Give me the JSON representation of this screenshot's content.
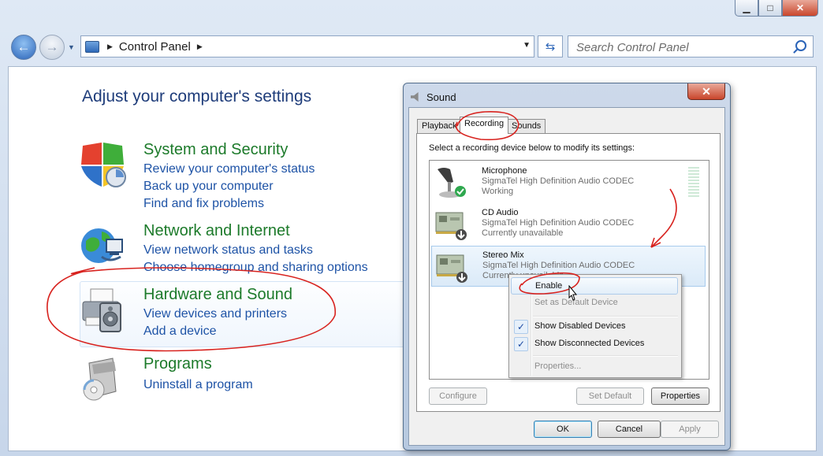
{
  "window": {
    "minimize_glyph": "▁",
    "maximize_glyph": "□",
    "close_glyph": "✕"
  },
  "nav": {
    "breadcrumb": "Control Panel",
    "search_placeholder": "Search Control Panel"
  },
  "control_panel": {
    "title": "Adjust your computer's settings",
    "categories": [
      {
        "title": "System and Security",
        "icon": "shield-icon",
        "links": [
          "Review your computer's status",
          "Back up your computer",
          "Find and fix problems"
        ]
      },
      {
        "title": "Network and Internet",
        "icon": "globe-network-icon",
        "links": [
          "View network status and tasks",
          "Choose homegroup and sharing options"
        ]
      },
      {
        "title": "Hardware and Sound",
        "icon": "printer-speaker-icon",
        "links": [
          "View devices and printers",
          "Add a device"
        ]
      },
      {
        "title": "Programs",
        "icon": "programs-box-icon",
        "links": [
          "Uninstall a program"
        ]
      }
    ]
  },
  "sound_dialog": {
    "title": "Sound",
    "close_glyph": "✕",
    "tabs": [
      "Playback",
      "Recording",
      "Sounds"
    ],
    "active_tab": "Recording",
    "instruction": "Select a recording device below to modify its settings:",
    "devices": [
      {
        "name": "Microphone",
        "driver": "SigmaTel High Definition Audio CODEC",
        "status": "Working",
        "icon": "microphone-icon",
        "badge": "check-badge-icon"
      },
      {
        "name": "CD Audio",
        "driver": "SigmaTel High Definition Audio CODEC",
        "status": "Currently unavailable",
        "icon": "sound-card-icon",
        "badge": "down-arrow-badge-icon"
      },
      {
        "name": "Stereo Mix",
        "driver": "SigmaTel High Definition Audio CODEC",
        "status": "Currently unavailable",
        "icon": "sound-card-icon",
        "badge": "down-arrow-badge-icon"
      }
    ],
    "buttons": {
      "configure": "Configure",
      "set_default": "Set Default",
      "properties": "Properties",
      "ok": "OK",
      "cancel": "Cancel",
      "apply": "Apply"
    }
  },
  "context_menu": {
    "items": [
      {
        "label": "Enable",
        "enabled": true,
        "checked": false
      },
      {
        "label": "Set as Default Device",
        "enabled": false,
        "checked": false
      },
      {
        "label": "Show Disabled Devices",
        "enabled": true,
        "checked": true
      },
      {
        "label": "Show Disconnected Devices",
        "enabled": true,
        "checked": true
      },
      {
        "label": "Properties...",
        "enabled": false,
        "checked": false
      }
    ],
    "check_glyph": "✓"
  },
  "colors": {
    "annotation_red": "#d8231f",
    "category_green": "#1c7a2a",
    "link_blue": "#1e53a6",
    "title_blue": "#1e3c7a"
  }
}
